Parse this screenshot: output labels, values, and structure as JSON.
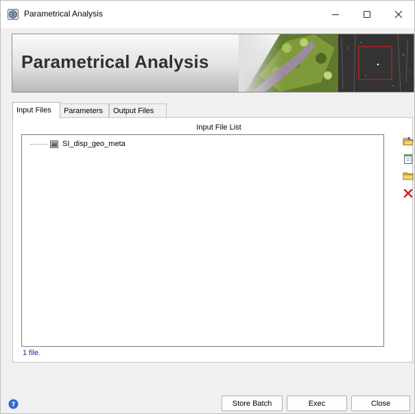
{
  "window": {
    "title": "Parametrical Analysis",
    "app_icon": "globe-app-icon",
    "controls": {
      "minimize": "minimize-icon",
      "maximize": "maximize-icon",
      "close": "close-icon"
    }
  },
  "banner": {
    "title": "Parametrical Analysis"
  },
  "tabs": [
    {
      "label": "Input Files",
      "active": true
    },
    {
      "label": "Parameters",
      "active": false
    },
    {
      "label": "Output Files",
      "active": false
    }
  ],
  "input_panel": {
    "list_caption": "Input File List",
    "files": [
      {
        "name": "SI_disp_geo_meta",
        "icon": "raster-file-icon"
      }
    ],
    "status": "1 file.",
    "side_actions": [
      {
        "name": "open-folder-button",
        "icon": "open-folder-icon"
      },
      {
        "name": "new-list-button",
        "icon": "document-icon"
      },
      {
        "name": "folder-button",
        "icon": "folder-icon"
      },
      {
        "name": "remove-file-button",
        "icon": "delete-x-icon"
      }
    ]
  },
  "footer": {
    "help_icon": "help-icon",
    "store_batch_label": "Store Batch",
    "exec_label": "Exec",
    "close_label": "Close"
  },
  "colors": {
    "accent_blue": "#2a6ad3",
    "delete_red": "#c8241c",
    "folder_yellow": "#e8b84a",
    "status_text": "#1a2aa0"
  }
}
